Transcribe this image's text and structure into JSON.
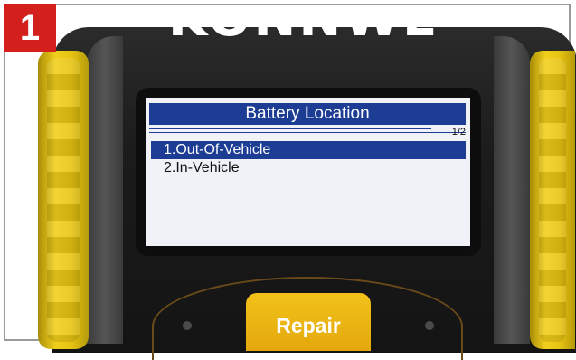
{
  "step": {
    "number": "1"
  },
  "device": {
    "brand": "KONNWEI",
    "colors": {
      "body": "#1b1b1b",
      "grip": "#f1cf1c",
      "accent": "#1d3d95",
      "badge": "#d4201c"
    }
  },
  "screen": {
    "title": "Battery Location",
    "page_indicator": "1/2",
    "menu": [
      {
        "label": "1.Out-Of-Vehicle",
        "selected": true
      },
      {
        "label": "2.In-Vehicle",
        "selected": false
      }
    ]
  },
  "keypad": {
    "repair_label": "Repair"
  }
}
